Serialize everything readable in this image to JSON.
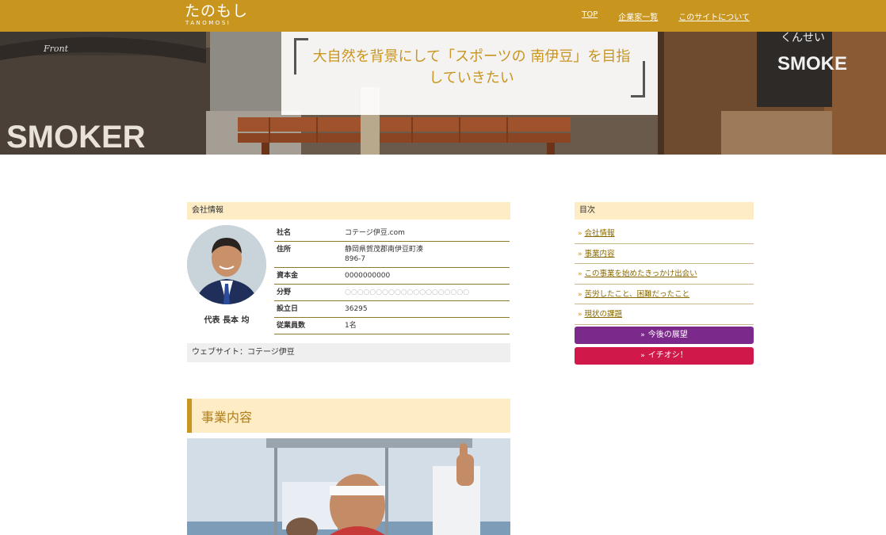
{
  "header": {
    "logo_main": "たのもし",
    "logo_sub": "TANOMOSI",
    "nav": [
      {
        "label": "TOP"
      },
      {
        "label": "企業家一覧"
      },
      {
        "label": "このサイトについて"
      }
    ]
  },
  "hero": {
    "quote_line1": "大自然を背景にして「スポーツの 南伊豆」を目指",
    "quote_line2": "していきたい",
    "sign_left": "SMOKER",
    "sign_left_small": "Front",
    "sign_right_top": "くんせい",
    "sign_right": "SMOKE"
  },
  "company": {
    "section_title": "会社情報",
    "representative": "代表 長本 均",
    "rows": [
      {
        "key": "社名",
        "value": "コテージ伊豆.com"
      },
      {
        "key": "住所",
        "value": "静岡県賀茂郡南伊豆町湊",
        "value2": "896-7"
      },
      {
        "key": "資本金",
        "value": "0000000000"
      },
      {
        "key": "分野",
        "value": "○○○○○○○○○○○○○○○○○○○○"
      },
      {
        "key": "設立日",
        "value": "36295"
      },
      {
        "key": "従業員数",
        "value": "1名"
      }
    ],
    "website": "ウェブサイト：コテージ伊豆"
  },
  "business": {
    "section_title": "事業内容"
  },
  "sidebar": {
    "toc_title": "目次",
    "items": [
      {
        "label": "会社情報"
      },
      {
        "label": "事業内容"
      },
      {
        "label": "この事業を始めたきっかけ出会い"
      },
      {
        "label": "苦労したこと、困難だったこと"
      },
      {
        "label": "現状の課題"
      }
    ],
    "btn_future": "今後の展望",
    "btn_ichioshi": "イチオシ！",
    "chevron_small": "»",
    "chevron_btn": "»"
  },
  "colors": {
    "brand": "#c8951f",
    "future_button": "#7b2a8c",
    "ichioshi_button": "#d0184a"
  }
}
